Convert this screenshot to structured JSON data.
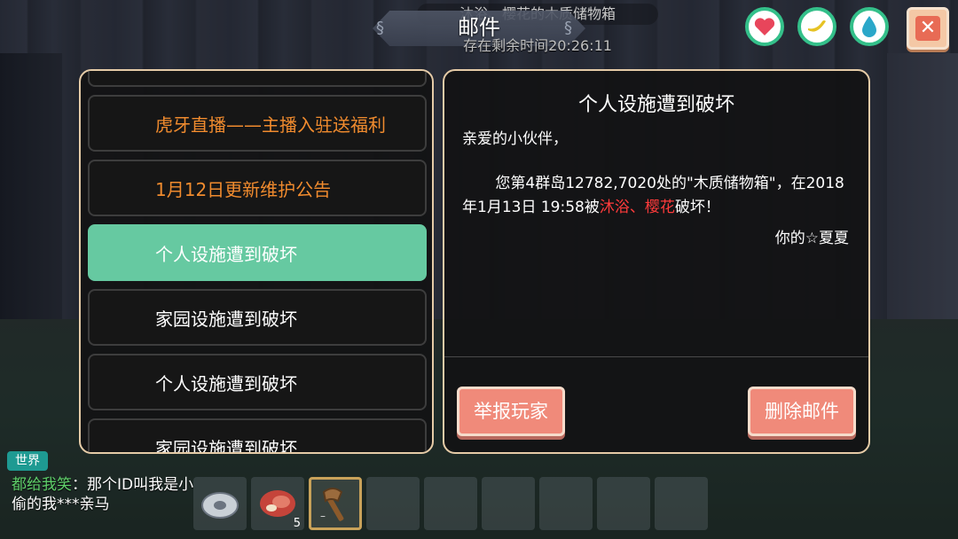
{
  "notice_text": "沐浴、樱花的木质储物箱",
  "window_title": "邮件",
  "timer_text": "存在剩余时间20:26:11",
  "stats": [
    {
      "name": "health",
      "icon": "heart-icon",
      "glyph": "♥",
      "color": "#e8455b"
    },
    {
      "name": "hunger",
      "icon": "banana-icon",
      "glyph": "☾",
      "color": "#e6c223"
    },
    {
      "name": "water",
      "icon": "water-drop-icon",
      "glyph": "●",
      "color": "#2aa7c9"
    }
  ],
  "close_glyph": "✕",
  "mail_list": {
    "items": [
      {
        "label": "",
        "style": "normal"
      },
      {
        "label": "虎牙直播——主播入驻送福利",
        "style": "orange"
      },
      {
        "label": "1月12日更新维护公告",
        "style": "orange"
      },
      {
        "label": "个人设施遭到破坏",
        "style": "active"
      },
      {
        "label": "家园设施遭到破坏",
        "style": "normal"
      },
      {
        "label": "个人设施遭到破坏",
        "style": "normal"
      },
      {
        "label": "家园设施遭到破坏",
        "style": "normal"
      }
    ]
  },
  "mail_detail": {
    "subject": "个人设施遭到破坏",
    "greeting": "亲爱的小伙伴，",
    "body_part1": "您第4群岛12782,7020处的\"木质储物箱\"，在2018年1月13日 19:58被",
    "body_attacker": "沐浴、樱花",
    "body_part2": "破坏！",
    "signature": "你的☆夏夏",
    "report_button": "举报玩家",
    "delete_button": "删除邮件"
  },
  "chat": {
    "channel": "世界",
    "sender": "都给我笑",
    "separator": "：",
    "message": "那个ID叫我是小偷的我***亲马"
  },
  "hotbar": {
    "slots": [
      {
        "item": "disc-icon",
        "count": ""
      },
      {
        "item": "meat-icon",
        "count": "5"
      },
      {
        "item": "stone-axe-icon",
        "count": "",
        "selected": true
      },
      {
        "item": "",
        "count": ""
      },
      {
        "item": "",
        "count": ""
      },
      {
        "item": "",
        "count": ""
      },
      {
        "item": "",
        "count": ""
      },
      {
        "item": "",
        "count": ""
      },
      {
        "item": "",
        "count": ""
      }
    ],
    "selected_marker": "–"
  }
}
